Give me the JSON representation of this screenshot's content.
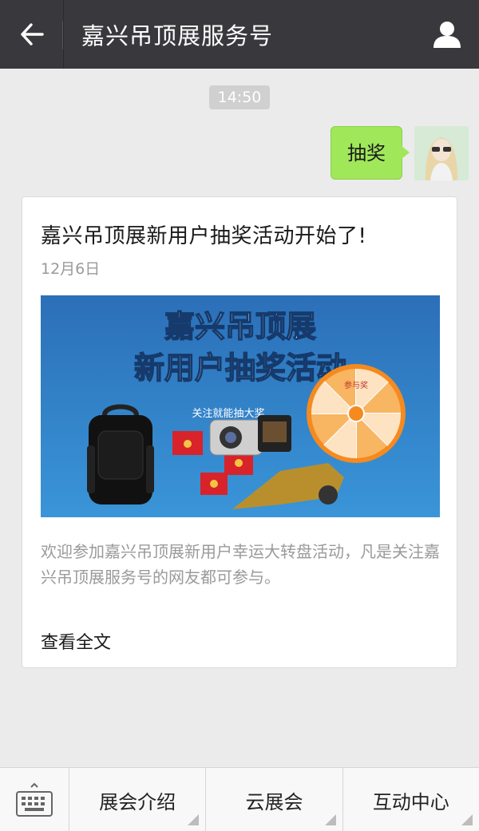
{
  "header": {
    "title": "嘉兴吊顶展服务号",
    "back_icon": "back-arrow-icon",
    "profile_icon": "user-profile-icon"
  },
  "chat": {
    "timestamp": "14:50",
    "sent_message": "抽奖"
  },
  "article": {
    "title": "嘉兴吊顶展新用户抽奖活动开始了!",
    "date": "12月6日",
    "banner": {
      "line1": "嘉兴吊顶展",
      "line2": "新用户抽奖活动",
      "tag": "关注就能抽大奖",
      "wheel_label": "参与奖"
    },
    "description": "欢迎参加嘉兴吊顶展新用户幸运大转盘活动，凡是关注嘉兴吊顶展服务号的网友都可参与。",
    "read_more": "查看全文"
  },
  "bottom_menu": {
    "keyboard_icon": "keyboard-icon",
    "items": [
      {
        "label": "展会介绍"
      },
      {
        "label": "云展会"
      },
      {
        "label": "互动中心"
      }
    ]
  },
  "colors": {
    "header_bg": "#39393d",
    "bubble_green": "#a0e75a",
    "banner_blue": "#2f7fc8"
  }
}
